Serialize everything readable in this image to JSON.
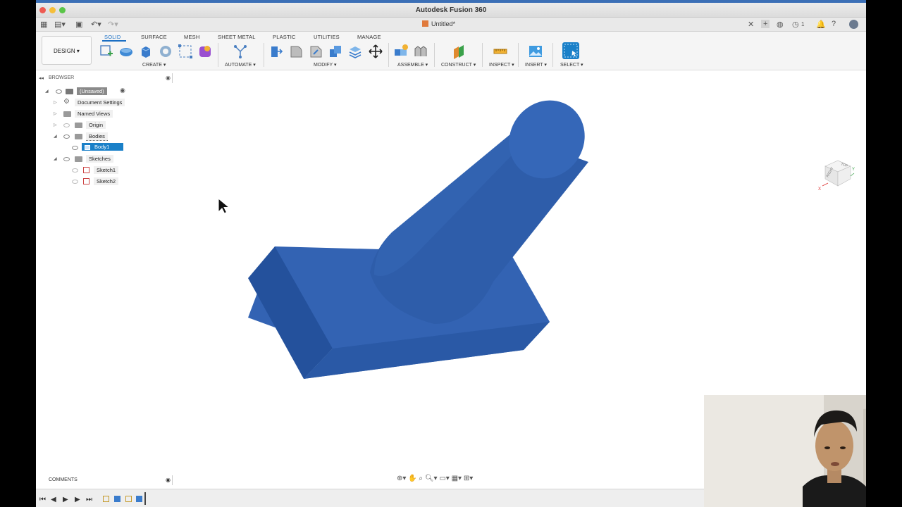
{
  "window": {
    "title": "Autodesk Fusion 360"
  },
  "document_tab": {
    "name": "Untitled*"
  },
  "workspace": {
    "label": "DESIGN ▾"
  },
  "toolbar_tabs": [
    "SOLID",
    "SURFACE",
    "MESH",
    "SHEET METAL",
    "PLASTIC",
    "UTILITIES",
    "MANAGE"
  ],
  "tool_groups": [
    "CREATE ▾",
    "AUTOMATE ▾",
    "MODIFY ▾",
    "ASSEMBLE ▾",
    "CONSTRUCT ▾",
    "INSPECT ▾",
    "INSERT ▾",
    "SELECT ▾"
  ],
  "browser": {
    "title": "BROWSER",
    "items": [
      "(Unsaved)",
      "Document Settings",
      "Named Views",
      "Origin",
      "Bodies",
      "Body1",
      "Sketches",
      "Sketch1",
      "Sketch2"
    ]
  },
  "viewcube": {
    "face_top": "TOP",
    "face_right": "RIGHT",
    "axis_x": "X",
    "axis_y": "Y",
    "axis_z": "Z"
  },
  "comments": {
    "label": "COMMENTS"
  },
  "notifications": {
    "count": "1"
  },
  "colors": {
    "body": "#2f5fae",
    "accent": "#1b6fc4",
    "selection": "#1a80c8"
  }
}
